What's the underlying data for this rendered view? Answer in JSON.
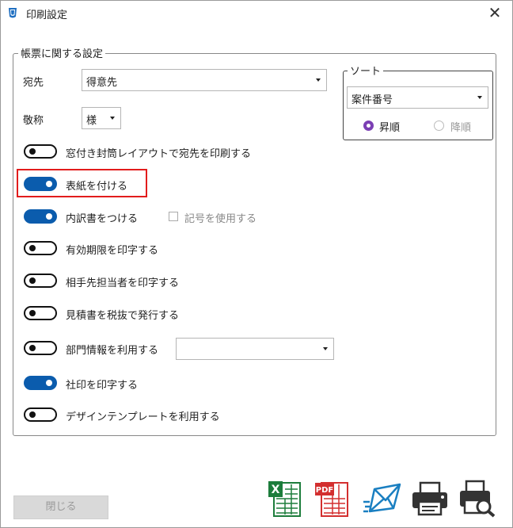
{
  "window": {
    "title": "印刷設定"
  },
  "group": {
    "legend": "帳票に関する設定",
    "destination": {
      "label": "宛先",
      "value": "得意先"
    },
    "honorific": {
      "label": "敬称",
      "value": "様"
    },
    "sort": {
      "legend": "ソート",
      "field": "案件番号",
      "ascending": "昇順",
      "descending": "降順",
      "selected": "昇順"
    },
    "options": [
      {
        "label": "窓付き封筒レイアウトで宛先を印刷する",
        "on": false
      },
      {
        "label": "表紙を付ける",
        "on": true
      },
      {
        "label": "内訳書をつける",
        "on": true
      },
      {
        "label": "有効期限を印字する",
        "on": false
      },
      {
        "label": "相手先担当者を印字する",
        "on": false
      },
      {
        "label": "見積書を税抜で発行する",
        "on": false
      },
      {
        "label": "部門情報を利用する",
        "on": false
      },
      {
        "label": "社印を印字する",
        "on": true
      },
      {
        "label": "デザインテンプレートを利用する",
        "on": false
      }
    ],
    "symbol_checkbox": {
      "label": "記号を使用する",
      "checked": false
    },
    "department_select": {
      "value": ""
    }
  },
  "footer": {
    "close_label": "閉じる",
    "excel_icon_text": "X",
    "pdf_icon_text": "PDF"
  },
  "colors": {
    "toggle_on": "#0b5cad",
    "highlight": "#e21c1c",
    "radio": "#7b3fb4"
  }
}
